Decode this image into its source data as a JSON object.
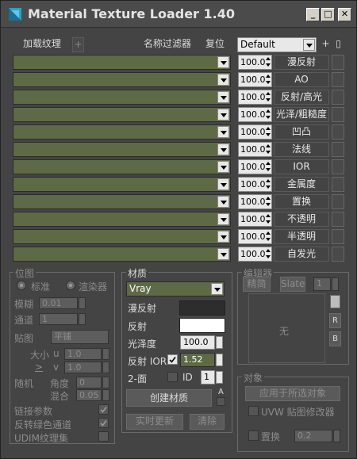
{
  "window": {
    "title": "Material Texture Loader 1.40",
    "min": "_",
    "restore": "□",
    "close": "✕"
  },
  "toolbar": {
    "add_texture": "加载纹理",
    "plus": "+",
    "name_filter": "名称过滤器",
    "reset": "复位",
    "preset": "Default",
    "preset_add": "+",
    "preset_rect": "▯"
  },
  "slots": [
    {
      "amount": "100.0",
      "label": "漫反射"
    },
    {
      "amount": "100.0",
      "label": "AO"
    },
    {
      "amount": "100.0",
      "label": "反射/高光"
    },
    {
      "amount": "100.0",
      "label": "光泽/粗糙度"
    },
    {
      "amount": "100.0",
      "label": "凹凸"
    },
    {
      "amount": "100.0",
      "label": "法线"
    },
    {
      "amount": "100.0",
      "label": "IOR"
    },
    {
      "amount": "100.0",
      "label": "金属度"
    },
    {
      "amount": "100.0",
      "label": "置换"
    },
    {
      "amount": "100.0",
      "label": "不透明"
    },
    {
      "amount": "100.0",
      "label": "半透明"
    },
    {
      "amount": "100.0",
      "label": "自发光"
    }
  ],
  "map_group": {
    "title": "位图",
    "radio_standard": "标准",
    "radio_renderer": "渲染器",
    "blur_label": "模糊",
    "blur_value": "0.01",
    "channel_label": "通道",
    "channel_value": "1",
    "map_label": "贴图",
    "map_value": "平铺",
    "size_label": "大小",
    "u_label": "u",
    "u_value": "1.0",
    "link_label": ">",
    "v_label": "v",
    "v_value": "1.0",
    "random_label": "随机",
    "angle_label": "角度",
    "angle_value": "0",
    "blend_label": "混合",
    "blend_value": "0.05",
    "link_params": "链接参数",
    "flip_green": "反转绿色通道",
    "udim": "UDIM纹理集"
  },
  "material_group": {
    "title": "材质",
    "type": "Vray",
    "diffuse_label": "漫反射",
    "diffuse_color": "#2d2d2d",
    "reflect_label": "反射",
    "reflect_color": "#ffffff",
    "gloss_label": "光泽度",
    "gloss_value": "100.0",
    "reflect_ior_label": "反射 IOR",
    "reflect_ior_value": "1.52",
    "two_side_label": "2-面",
    "id_label": "ID",
    "id_value": "1",
    "create_btn": "创建材质",
    "a_label": "A",
    "live_update": "实时更新",
    "clear": "清除"
  },
  "editor_group": {
    "title": "编辑器",
    "compact": "精简",
    "slate": "Slate",
    "slot_value": "1",
    "empty_label": "无",
    "r_btn": "R",
    "b_btn": "B"
  },
  "object_group": {
    "title": "对象",
    "apply_selected": "应用于所选对象",
    "uvw_label": "UVW 贴图修改器",
    "displace_label": "置换",
    "displace_value": "0.2"
  }
}
